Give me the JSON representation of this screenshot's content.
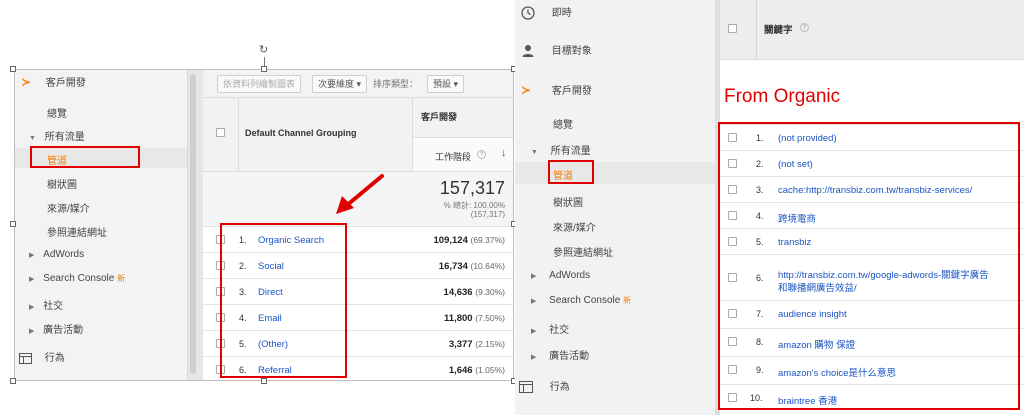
{
  "left": {
    "nav": {
      "acquisition": "客戶開發",
      "overview": "總覽",
      "all_traffic": "所有流量",
      "channels": "管道",
      "treemaps": "樹狀圖",
      "source_medium": "來源/媒介",
      "referrals": "參照連結網址",
      "adwords": "AdWords",
      "search_console": "Search Console",
      "new_badge": "新",
      "social": "社交",
      "campaigns": "廣告活動",
      "behavior": "行為"
    },
    "toolbar": {
      "plot_rows": "依資料列繪製圖表",
      "secondary_dim": "次要維度 ▾",
      "sort_type_label": "排序類型：",
      "default": "預設 ▾"
    },
    "table": {
      "col_channel": "Default Channel Grouping",
      "col_acq_group": "客戶開發",
      "col_sessions": "工作階段",
      "total_value": "157,317",
      "total_pct": "% 總計: 100.00%",
      "total_paren": "(157,317)",
      "rows": [
        {
          "num": "1.",
          "name": "Organic Search",
          "value": "109,124",
          "pct": "(69.37%)"
        },
        {
          "num": "2.",
          "name": "Social",
          "value": "16,734",
          "pct": "(10.64%)"
        },
        {
          "num": "3.",
          "name": "Direct",
          "value": "14,636",
          "pct": "(9.30%)"
        },
        {
          "num": "4.",
          "name": "Email",
          "value": "11,800",
          "pct": "(7.50%)"
        },
        {
          "num": "5.",
          "name": "(Other)",
          "value": "3,377",
          "pct": "(2.15%)"
        },
        {
          "num": "6.",
          "name": "Referral",
          "value": "1,646",
          "pct": "(1.05%)"
        }
      ]
    }
  },
  "right": {
    "nav": {
      "realtime": "即時",
      "audience": "目標對象",
      "acquisition": "客戶開發",
      "overview": "總覽",
      "all_traffic": "所有流量",
      "channels": "管道",
      "treemaps": "樹狀圖",
      "source_medium": "來源/媒介",
      "referrals": "參照連結網址",
      "adwords": "AdWords",
      "search_console": "Search Console",
      "new_badge": "新",
      "social": "社交",
      "campaigns": "廣告活動",
      "behavior": "行為"
    },
    "table": {
      "col_keyword": "關鍵字",
      "annotation": "From Organic",
      "rows": [
        {
          "num": "1.",
          "keyword": "(not provided)"
        },
        {
          "num": "2.",
          "keyword": "(not set)"
        },
        {
          "num": "3.",
          "keyword": "cache:http://transbiz.com.tw/transbiz-services/"
        },
        {
          "num": "4.",
          "keyword": "跨境電商"
        },
        {
          "num": "5.",
          "keyword": "transbiz"
        },
        {
          "num": "6.",
          "keyword": "http://transbiz.com.tw/google-adwords-關鍵字廣告",
          "keyword2": "和聯播網廣告效益/"
        },
        {
          "num": "7.",
          "keyword": "audience insight"
        },
        {
          "num": "8.",
          "keyword": "amazon 購物 保證"
        },
        {
          "num": "9.",
          "keyword": "amazon's choice是什么意思"
        },
        {
          "num": "10.",
          "keyword": "braintree 香港"
        }
      ]
    }
  },
  "colors": {
    "accent": "#f57c00",
    "link": "#1a55c4",
    "highlight_red": "#e00000"
  }
}
